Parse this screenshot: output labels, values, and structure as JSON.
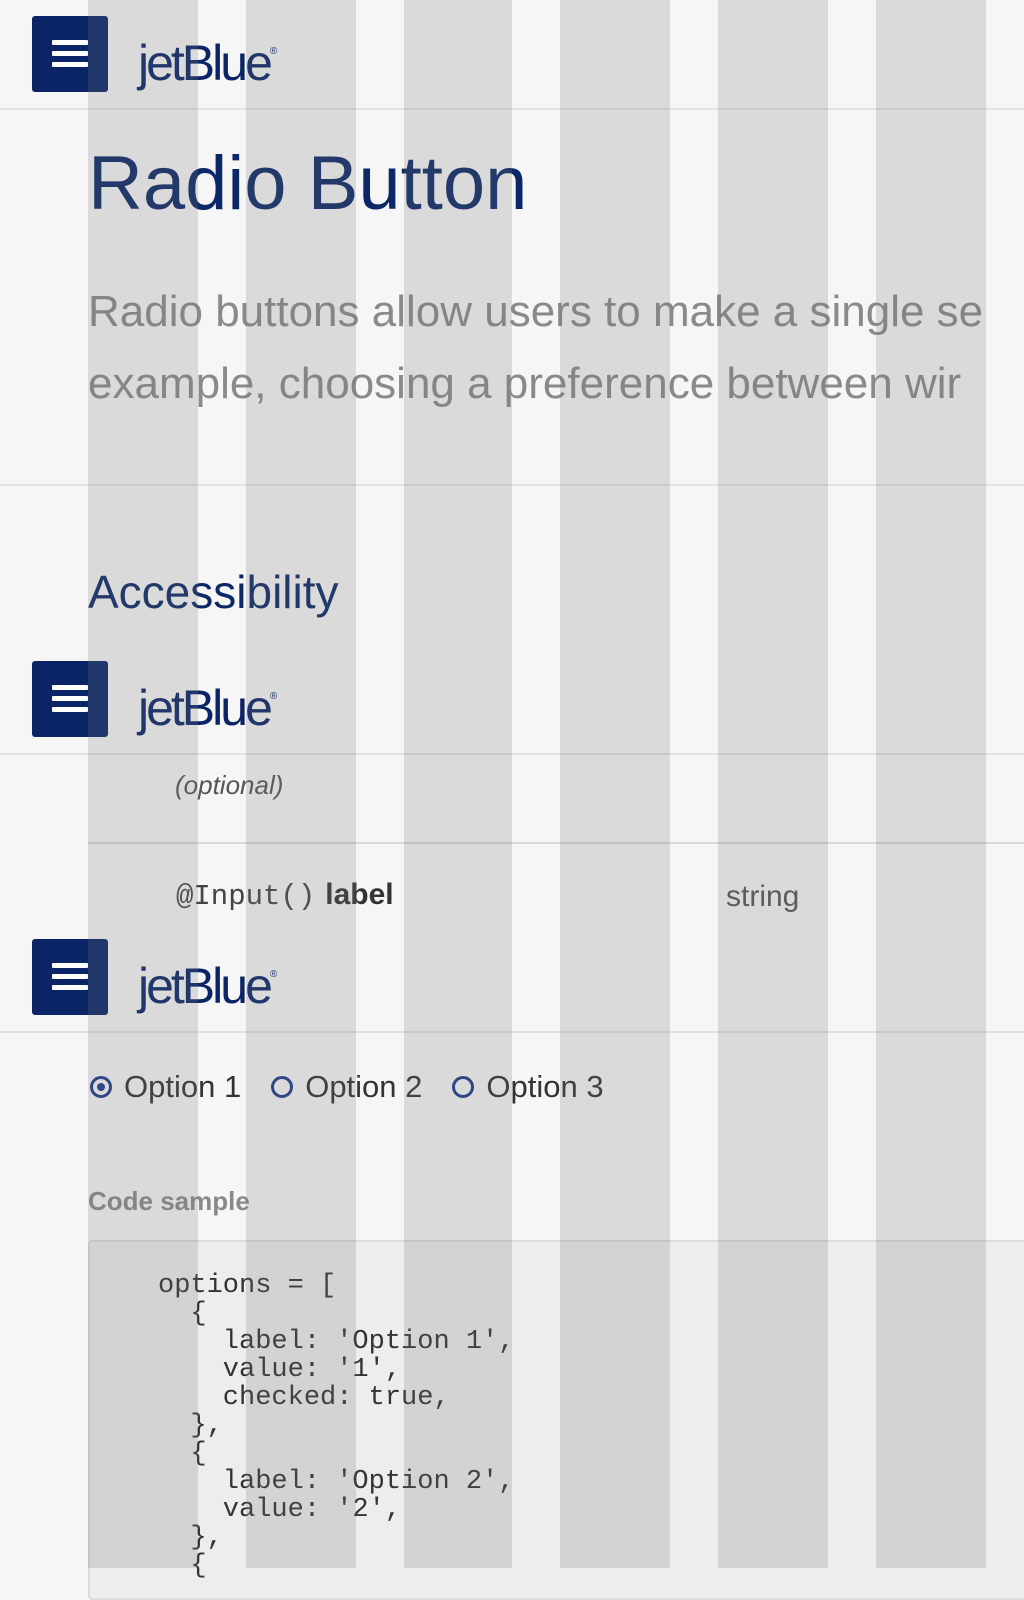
{
  "header": {
    "menu_icon": "hamburger-menu-icon",
    "brand_name": "jetBlue",
    "brand_registered": "®",
    "brand_color": "#0a2466"
  },
  "page": {
    "title": "Radio Button",
    "intro_line_1": "Radio buttons allow users to make a single se",
    "intro_line_2": "example, choosing a preference between wir"
  },
  "accessibility": {
    "heading": "Accessibility"
  },
  "api_table": {
    "optional_label": "(optional)",
    "row": {
      "decorator": "@Input()",
      "property": "label",
      "type": "string"
    }
  },
  "demo": {
    "radio_options": [
      {
        "label": "Option 1",
        "checked": true
      },
      {
        "label": "Option 2",
        "checked": false
      },
      {
        "label": "Option 3",
        "checked": false
      }
    ],
    "cut_off_text": "' ' ' '"
  },
  "code_sample": {
    "label": "Code sample",
    "code": "options = [\n  {\n    label: 'Option 1',\n    value: '1',\n    checked: true,\n  },\n  {\n    label: 'Option 2',\n    value: '2',\n  },\n  {"
  },
  "colors": {
    "primary_navy": "#0a2466",
    "radio_accent": "#1b3a8c",
    "page_background": "#f6f6f6"
  }
}
